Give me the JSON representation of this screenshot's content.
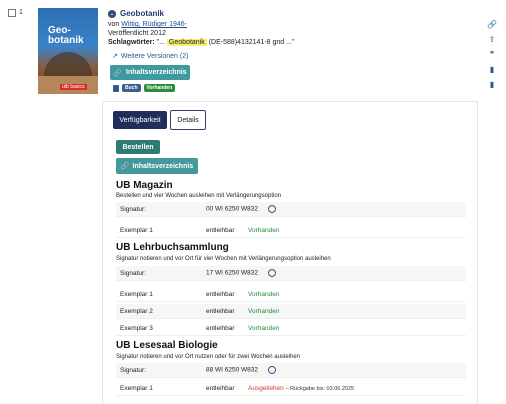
{
  "record": {
    "number": "1",
    "title": "Geobotanik",
    "author_prefix": "von",
    "author": "Wittig, Rüdiger 1946-",
    "published": "Veröffentlicht 2012",
    "keywords_label": "Schlagwörter:",
    "keywords_pre": "\"...",
    "keywords_highlight": "Geobotanik",
    "keywords_post": "(DE-588)4132141-8 gnd ...\"",
    "more_versions": "Weitere Versionen (2)",
    "toc_button": "Inhaltsverzeichnis",
    "badge_buch": "Buch",
    "badge_vorhanden": "Vorhanden"
  },
  "cover": {
    "title_line1": "Geo-",
    "title_line2": "botanik",
    "badge": "utb basics"
  },
  "tabs": {
    "availability": "Verfügbarkeit",
    "details": "Details"
  },
  "actions": {
    "order": "Bestellen",
    "toc": "Inhaltsverzeichnis"
  },
  "sections": [
    {
      "title": "UB Magazin",
      "subtitle": "Bestellen und vier Wochen ausleihen mit Verlängerungsoption",
      "signatur_label": "Signatur:",
      "signatur": "00 WI 6250 W832",
      "items": [
        {
          "label": "Exemplar 1",
          "type": "entleihbar",
          "status": "Vorhanden",
          "note": ""
        }
      ]
    },
    {
      "title": "UB Lehrbuchsammlung",
      "subtitle": "Signatur notieren und vor Ort für vier Wochen mit Verlängerungsoption ausleihen",
      "signatur_label": "Signatur:",
      "signatur": "17 WI 6250 W832",
      "items": [
        {
          "label": "Exemplar 1",
          "type": "entleihbar",
          "status": "Vorhanden",
          "note": ""
        },
        {
          "label": "Exemplar 2",
          "type": "entleihbar",
          "status": "Vorhanden",
          "note": ""
        },
        {
          "label": "Exemplar 3",
          "type": "entleihbar",
          "status": "Vorhanden",
          "note": ""
        }
      ]
    },
    {
      "title": "UB Lesesaal Biologie",
      "subtitle": "Signatur notieren und vor Ort nutzen oder für zwei Wochen ausleihen",
      "signatur_label": "Signatur:",
      "signatur": "88 WI 6250 W832",
      "items": [
        {
          "label": "Exemplar 1",
          "type": "entleihbar",
          "status": "Ausgeliehen",
          "note": "– Rückgabe bis: 03.06.2025"
        }
      ]
    }
  ],
  "colors": {
    "primary_dark": "#1f2f5a",
    "teal": "#2e7b74",
    "teal_light": "#45999a",
    "available": "#2a8a2f",
    "loaned": "#d0392b"
  },
  "icons": {
    "side": [
      "link-icon",
      "export-icon",
      "cite-icon",
      "bookmark-icon",
      "bookmark-list-icon"
    ]
  }
}
